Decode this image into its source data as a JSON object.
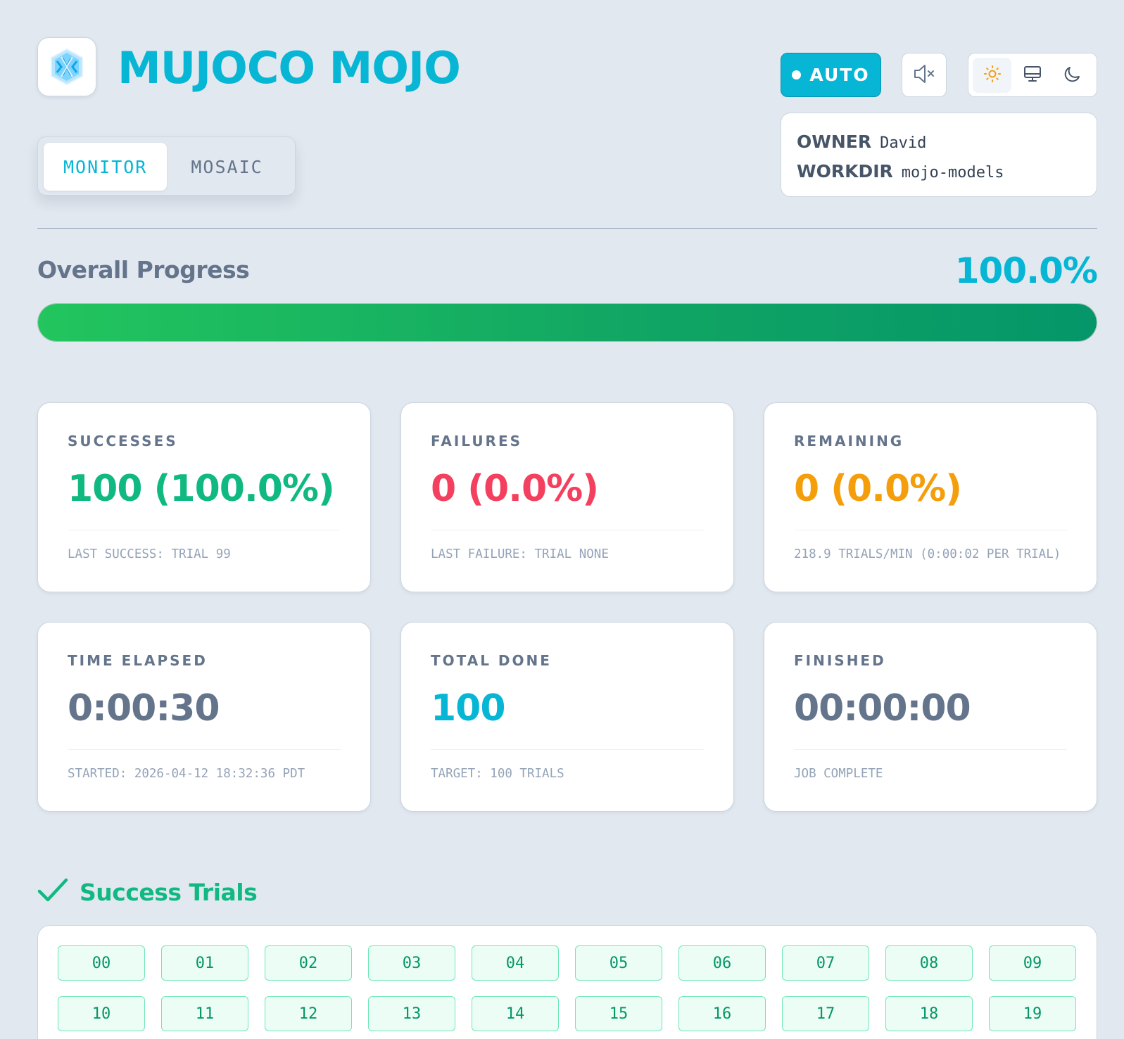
{
  "app": {
    "title": "MUJOCO MOJO",
    "logo_icon": "crystal-logo-icon"
  },
  "nav": {
    "tabs": [
      {
        "label": "MONITOR",
        "active": true
      },
      {
        "label": "MOSAIC",
        "active": false
      }
    ]
  },
  "controls": {
    "auto_label": "AUTO",
    "mute_icon": "speaker-muted-icon",
    "theme_options": [
      {
        "icon": "sun-icon",
        "active": true
      },
      {
        "icon": "monitor-icon",
        "active": false
      },
      {
        "icon": "moon-icon",
        "active": false
      }
    ]
  },
  "info": {
    "owner_key": "OWNER",
    "owner_value": "David",
    "workdir_key": "WORKDIR",
    "workdir_value": "mojo-models"
  },
  "progress": {
    "label": "Overall Progress",
    "percent_text": "100.0%",
    "fraction": 1.0
  },
  "cards": [
    {
      "label": "SUCCESSES",
      "value": "100 (100.0%)",
      "footer": "LAST SUCCESS: TRIAL 99",
      "color": "#10b981"
    },
    {
      "label": "FAILURES",
      "value": "0 (0.0%)",
      "footer": "LAST FAILURE: TRIAL NONE",
      "color": "#f43f5e"
    },
    {
      "label": "REMAINING",
      "value": "0 (0.0%)",
      "footer": "218.9 TRIALS/MIN (0:00:02 PER TRIAL)",
      "color": "#f59e0b"
    },
    {
      "label": "TIME ELAPSED",
      "value": "0:00:30",
      "footer": "STARTED: 2026-04-12 18:32:36 PDT",
      "color": "#64748b"
    },
    {
      "label": "TOTAL DONE",
      "value": "100",
      "footer": "TARGET: 100 TRIALS",
      "color": "#06b6d4"
    },
    {
      "label": "FINISHED",
      "value": "00:00:00",
      "footer": "JOB COMPLETE",
      "color": "#64748b"
    }
  ],
  "success_trials": {
    "title": "Success Trials",
    "icon": "checkmark-icon",
    "items": [
      "00",
      "01",
      "02",
      "03",
      "04",
      "05",
      "06",
      "07",
      "08",
      "09",
      "10",
      "11",
      "12",
      "13",
      "14",
      "15",
      "16",
      "17",
      "18",
      "19"
    ]
  },
  "colors": {
    "accent": "#06b6d4",
    "success": "#10b981",
    "failure": "#f43f5e",
    "warning": "#f59e0b"
  }
}
